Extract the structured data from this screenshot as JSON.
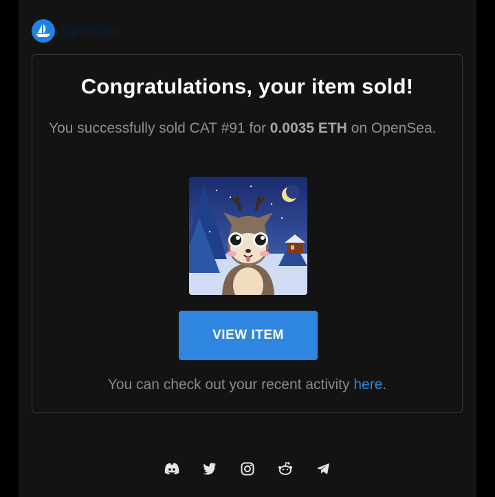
{
  "brand": {
    "name": "OpenSea",
    "accent": "#2081e2"
  },
  "email": {
    "title": "Congratulations, your item sold!",
    "desc_prefix": "You successfully sold CAT #91 for ",
    "amount": "0.0035 ETH",
    "desc_suffix": " on OpenSea.",
    "button_label": "VIEW ITEM",
    "note_prefix": "You can check out your recent activity ",
    "note_link": "here",
    "note_suffix": "."
  },
  "nft": {
    "alt": "CAT #91 artwork"
  },
  "socials": [
    {
      "icon": "discord-icon"
    },
    {
      "icon": "twitter-icon"
    },
    {
      "icon": "instagram-icon"
    },
    {
      "icon": "reddit-icon"
    },
    {
      "icon": "telegram-icon"
    }
  ]
}
